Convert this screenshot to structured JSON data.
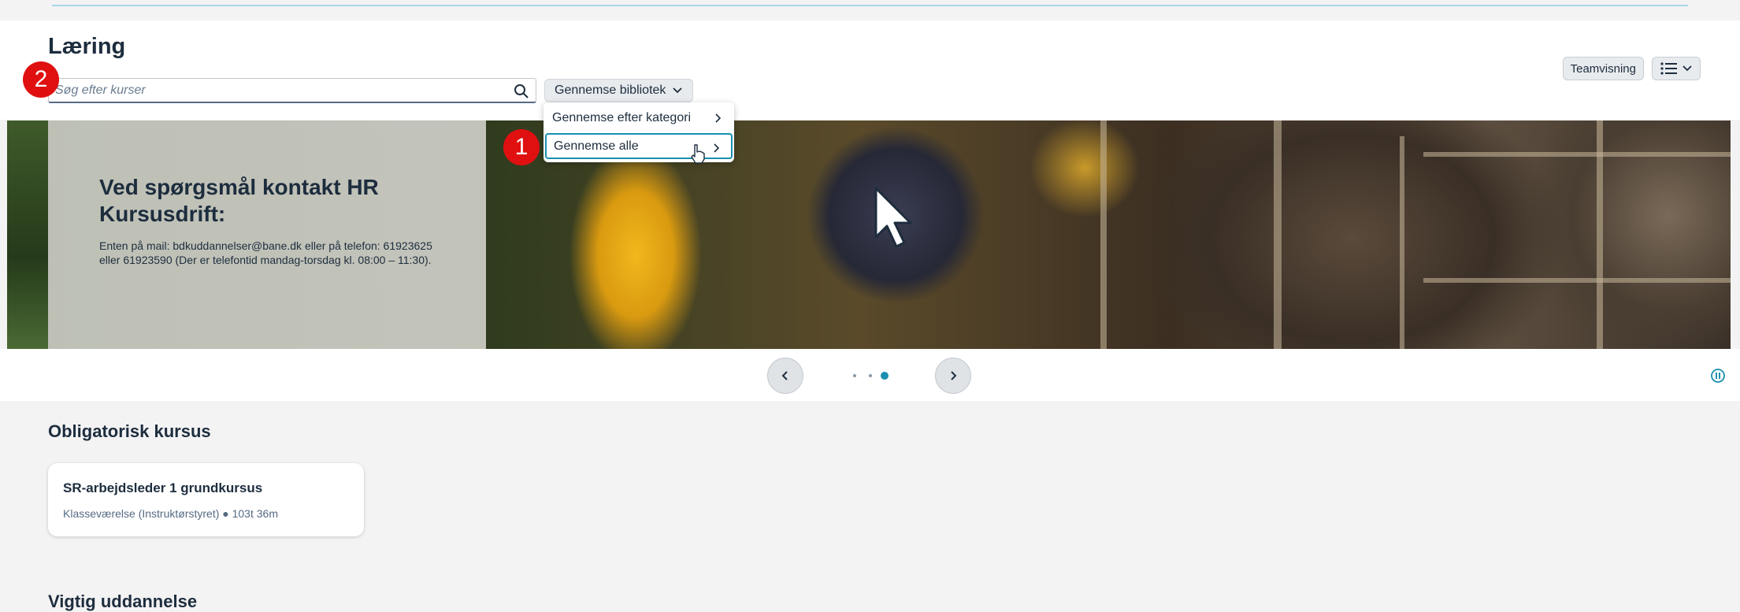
{
  "page": {
    "title": "Læring"
  },
  "search": {
    "placeholder": "Søg efter kurser"
  },
  "toolbar": {
    "browse_label": "Gennemse bibliotek",
    "team_view_label": "Teamvisning"
  },
  "browse_menu": {
    "items": [
      {
        "label": "Gennemse efter kategori"
      },
      {
        "label": "Gennemse alle"
      }
    ]
  },
  "hero": {
    "heading": "Ved spørgsmål kontakt HR Kursusdrift:",
    "body": "Enten på mail: bdkuddannelser@bane.dk eller på telefon: 61923625 eller 61923590 (Der er telefontid mandag-torsdag kl. 08:00 – 11:30)."
  },
  "carousel": {
    "slide_count": 3,
    "active_index": 2
  },
  "sections": {
    "mandatory": {
      "title": "Obligatorisk kursus",
      "courses": [
        {
          "title": "SR-arbejdsleder 1 grundkursus",
          "meta": "Klasseværelse (Instruktørstyret) ● 103t 36m"
        }
      ]
    },
    "important": {
      "title": "Vigtig uddannelse"
    }
  },
  "annotations": {
    "step_1": "1",
    "step_2": "2"
  },
  "colors": {
    "accent": "#1a8fb0",
    "badge": "#e01010",
    "text": "#1d2d3e"
  }
}
